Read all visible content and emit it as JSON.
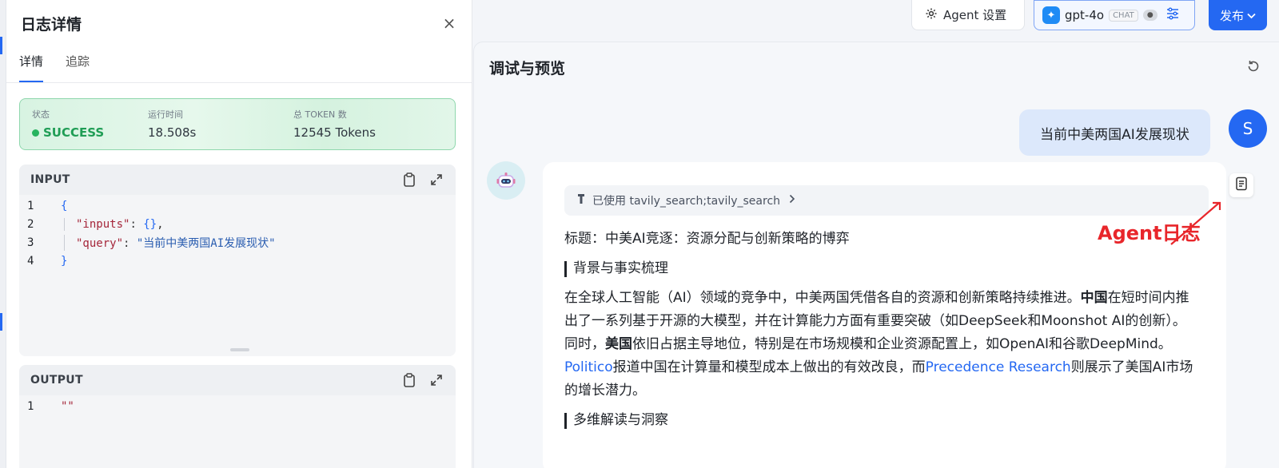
{
  "drawer": {
    "title": "日志详情",
    "close_icon": "×",
    "tabs": [
      {
        "label": "详情",
        "active": true
      },
      {
        "label": "追踪",
        "active": false
      }
    ],
    "status": {
      "state_label": "状态",
      "state_value": "SUCCESS",
      "runtime_label": "运行时间",
      "runtime_value": "18.508s",
      "tokens_label": "总 TOKEN 数",
      "tokens_value": "12545 Tokens"
    },
    "input": {
      "title": "INPUT",
      "line_numbers": [
        "1",
        "2",
        "3",
        "4"
      ],
      "key_inputs": "\"inputs\"",
      "val_inputs": "{}",
      "key_query": "\"query\"",
      "val_query": "\"当前中美两国AI发展现状\""
    },
    "output": {
      "title": "OUTPUT",
      "line_numbers": [
        "1"
      ],
      "value": "\"\""
    }
  },
  "topbar": {
    "agent_settings_label": "Agent 设置",
    "model_name": "gpt-4o",
    "model_tag": "CHAT",
    "publish_label": "发布"
  },
  "preview": {
    "title": "调试与预览",
    "user_message": "当前中美两国AI发展现状",
    "user_avatar_letter": "S",
    "tool_usage": "已使用 tavily_search;tavily_search",
    "answer": {
      "heading": "标题：中美AI竞逐：资源分配与创新策略的博弈",
      "section1": "背景与事实梳理",
      "para_a": "在全球人工智能（AI）领域的竞争中，中美两国凭借各自的资源和创新策略持续推进。",
      "para_china": "中国",
      "para_b": "在短时间内推出了一系列基于开源的大模型，并在计算能力方面有重要突破（如DeepSeek和Moonshot AI的创新）。同时，",
      "para_us": "美国",
      "para_c": "依旧占据主导地位，特别是在市场规模和企业资源配置上，如OpenAI和谷歌DeepMind。",
      "link1": "Politico",
      "para_d": "报道中国在计算量和模型成本上做出的有效改良，而",
      "link2": "Precedence Research",
      "para_e": "则展示了美国AI市场的增长潜力。",
      "section2": "多维解读与洞察"
    },
    "annotation": "Agent日志"
  },
  "colors": {
    "accent": "#2468f2",
    "success": "#27b35f",
    "annotation": "#e8262b"
  }
}
